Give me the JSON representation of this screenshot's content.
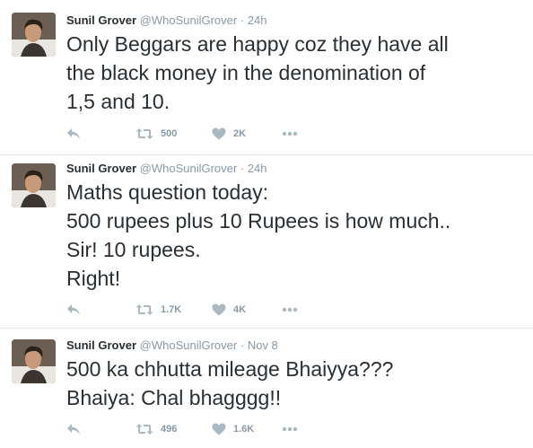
{
  "tweets": [
    {
      "name": "Sunil Grover",
      "handle": "@WhoSunilGrover",
      "separator": "·",
      "time": "24h",
      "lines": [
        "Only Beggars are happy coz they have all",
        "the black money in the denomination of",
        "1,5 and 10."
      ],
      "retweets": "500",
      "likes": "2K"
    },
    {
      "name": "Sunil Grover",
      "handle": "@WhoSunilGrover",
      "separator": "·",
      "time": "24h",
      "lines": [
        "Maths question today:",
        "500 rupees plus 10 Rupees is how much..",
        "Sir! 10 rupees.",
        "Right!"
      ],
      "retweets": "1.7K",
      "likes": "4K"
    },
    {
      "name": "Sunil Grover",
      "handle": "@WhoSunilGrover",
      "separator": "·",
      "time": "Nov 8",
      "lines": [
        "500 ka chhutta mileage Bhaiyya???",
        "Bhaiya: Chal bhagggg!!"
      ],
      "retweets": "496",
      "likes": "1.6K"
    }
  ],
  "icons": {
    "reply": "reply-icon",
    "retweet": "retweet-icon",
    "like": "heart-icon",
    "more": "more-icon"
  },
  "colors": {
    "action_icon": "#aab8c2",
    "muted_text": "#8899a6",
    "divider": "#e1e8ed"
  }
}
